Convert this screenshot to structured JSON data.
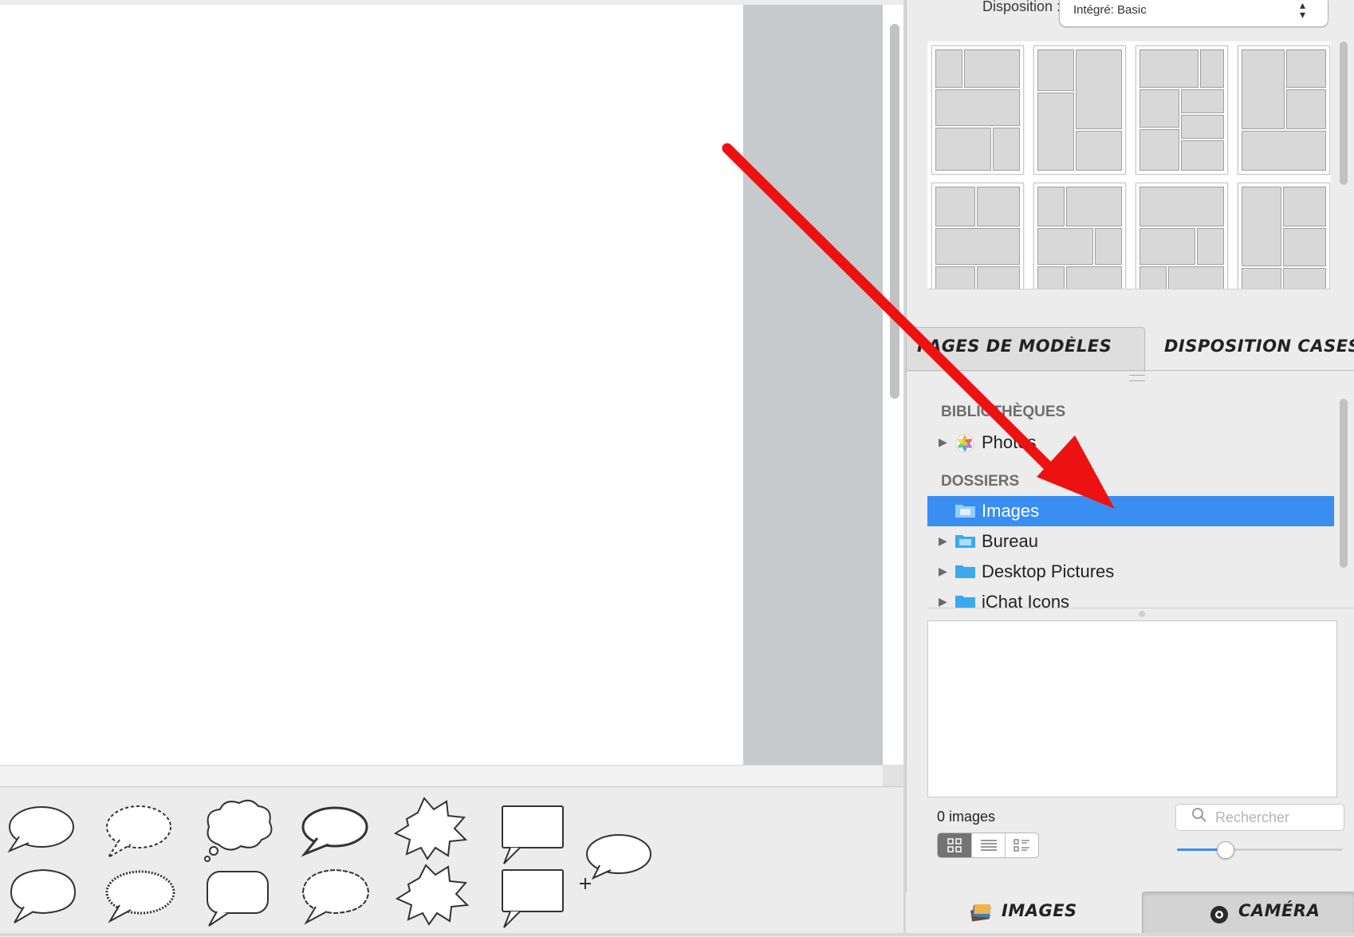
{
  "disposition": {
    "label": "Disposition :",
    "selected": "Intégré: Basic"
  },
  "tabs": {
    "modeles": "PAGES DE MODÈLES",
    "disposition_cases": "DISPOSITION CASES"
  },
  "sources": {
    "libraries_header": "BIBLIOTHÈQUES",
    "libraries": [
      {
        "label": "Photos",
        "icon": "photos-app-icon"
      }
    ],
    "folders_header": "DOSSIERS",
    "folders": [
      {
        "label": "Images",
        "icon": "pictures-folder-icon",
        "selected": true
      },
      {
        "label": "Bureau",
        "icon": "desktop-folder-icon"
      },
      {
        "label": "Desktop Pictures",
        "icon": "folder-icon"
      },
      {
        "label": "iChat Icons",
        "icon": "folder-icon"
      }
    ]
  },
  "browser": {
    "count": "0 images",
    "search_placeholder": "Rechercher",
    "zoom_level": 0.25
  },
  "bottom_tabs": {
    "images": "IMAGES",
    "camera": "CAMÉRA"
  },
  "colors": {
    "selection": "#3a8ef2",
    "annotation_arrow": "#ee1111"
  }
}
